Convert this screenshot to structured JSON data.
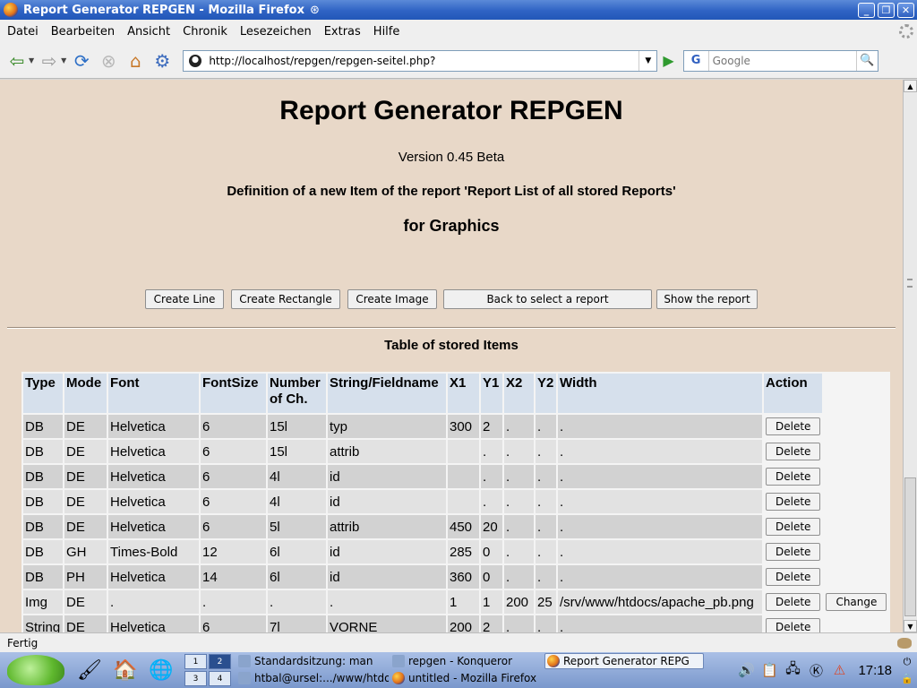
{
  "window": {
    "title": "Report Generator REPGEN - Mozilla Firefox",
    "buttons": [
      "_",
      "❐",
      "✕"
    ]
  },
  "menubar": {
    "items": [
      "Datei",
      "Bearbeiten",
      "Ansicht",
      "Chronik",
      "Lesezeichen",
      "Extras",
      "Hilfe"
    ]
  },
  "navbar": {
    "url": "http://localhost/repgen/repgen-seitel.php?",
    "search_engine": "G",
    "search_placeholder": "Google"
  },
  "page": {
    "title": "Report Generator REPGEN",
    "version": "Version 0.45 Beta",
    "definition": "Definition of a new Item of the report 'Report List of all stored Reports'",
    "for_graphics": "for Graphics",
    "buttons": {
      "create_line": "Create Line",
      "create_rectangle": "Create Rectangle",
      "create_image": "Create Image",
      "back_to_select": "Back to select a report",
      "show_report": "Show the report"
    },
    "table_title": "Table of stored Items",
    "table": {
      "headers": [
        "Type",
        "Mode",
        "Font",
        "FontSize",
        "Number of Ch.",
        "String/Fieldname",
        "X1",
        "Y1",
        "X2",
        "Y2",
        "Width",
        "Action"
      ],
      "rows": [
        {
          "cells": [
            "DB",
            "DE",
            "Helvetica",
            "6",
            "15l",
            "typ",
            "300",
            "2",
            ".",
            ".",
            "."
          ],
          "delete": "Delete"
        },
        {
          "cells": [
            "DB",
            "DE",
            "Helvetica",
            "6",
            "15l",
            "attrib",
            "",
            ".",
            ".",
            ".",
            "."
          ],
          "delete": "Delete"
        },
        {
          "cells": [
            "DB",
            "DE",
            "Helvetica",
            "6",
            "4l",
            "id",
            "",
            ".",
            ".",
            ".",
            "."
          ],
          "delete": "Delete"
        },
        {
          "cells": [
            "DB",
            "DE",
            "Helvetica",
            "6",
            "4l",
            "id",
            "",
            ".",
            ".",
            ".",
            "."
          ],
          "delete": "Delete"
        },
        {
          "cells": [
            "DB",
            "DE",
            "Helvetica",
            "6",
            "5l",
            "attrib",
            "450",
            "20",
            ".",
            ".",
            "."
          ],
          "delete": "Delete"
        },
        {
          "cells": [
            "DB",
            "GH",
            "Times-Bold",
            "12",
            "6l",
            "id",
            "285",
            "0",
            ".",
            ".",
            "."
          ],
          "delete": "Delete"
        },
        {
          "cells": [
            "DB",
            "PH",
            "Helvetica",
            "14",
            "6l",
            "id",
            "360",
            "0",
            ".",
            ".",
            "."
          ],
          "delete": "Delete"
        },
        {
          "cells": [
            "Img",
            "DE",
            ".",
            ".",
            ".",
            ".",
            "1",
            "1",
            "200",
            "25",
            "/srv/www/htdocs/apache_pb.png"
          ],
          "delete": "Delete",
          "change": "Change"
        },
        {
          "cells": [
            "String",
            "DE",
            "Helvetica",
            "6",
            "7l",
            "VORNE",
            "200",
            "2",
            ".",
            ".",
            "."
          ],
          "delete": "Delete"
        }
      ]
    }
  },
  "statusbar": {
    "text": "Fertig"
  },
  "taskbar": {
    "pager": [
      "1",
      "2",
      "3",
      "4"
    ],
    "tasks": [
      "Standardsitzung: man",
      "repgen - Konqueror",
      "Report Generator REPG",
      "htbal@ursel:.../www/htdo",
      "untitled - Mozilla Firefox"
    ],
    "clock": "17:18"
  },
  "colors": {
    "page_background": "#e8d8c8",
    "header_cell": "#d6e0ec",
    "row_dark": "#d2d2d2",
    "row_light": "#e2e2e2",
    "titlebar": "#2f63c4"
  }
}
